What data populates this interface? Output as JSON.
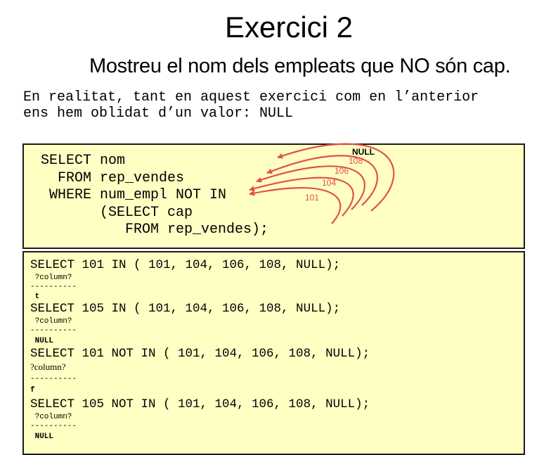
{
  "title": "Exercici 2",
  "subtitle": "Mostreu el nom dels empleats que NO són cap.",
  "intro": {
    "line1": "En realitat, tant en aquest exercici com en l’anterior",
    "line2": "ens hem oblidat d’un valor: NULL"
  },
  "query": {
    "line1": "SELECT nom",
    "line2": "  FROM rep_vendes",
    "line3": " WHERE num_empl NOT IN",
    "line4": "       (SELECT cap",
    "line5": "          FROM rep_vendes);"
  },
  "arc_labels": [
    "NULL",
    "108",
    "106",
    "104",
    "101"
  ],
  "results": [
    {
      "query": "SELECT 101 IN ( 101, 104, 106, 108, NULL);",
      "column": " ?column?",
      "separator": "----------",
      "value": " t"
    },
    {
      "query": "SELECT 105 IN ( 101, 104, 106, 108, NULL);",
      "column": " ?column?",
      "separator": "----------",
      "value": " NULL"
    },
    {
      "query": "SELECT 101 NOT IN ( 101, 104, 106, 108, NULL);",
      "column": "?column?",
      "separator": "----------",
      "value": "f"
    },
    {
      "query": "SELECT 105 NOT IN ( 101, 104, 106, 108, NULL);",
      "column": " ?column?",
      "separator": "----------",
      "value": " NULL"
    }
  ],
  "colors": {
    "box_bg": "#ffffc4",
    "arrow": "#e05050"
  }
}
